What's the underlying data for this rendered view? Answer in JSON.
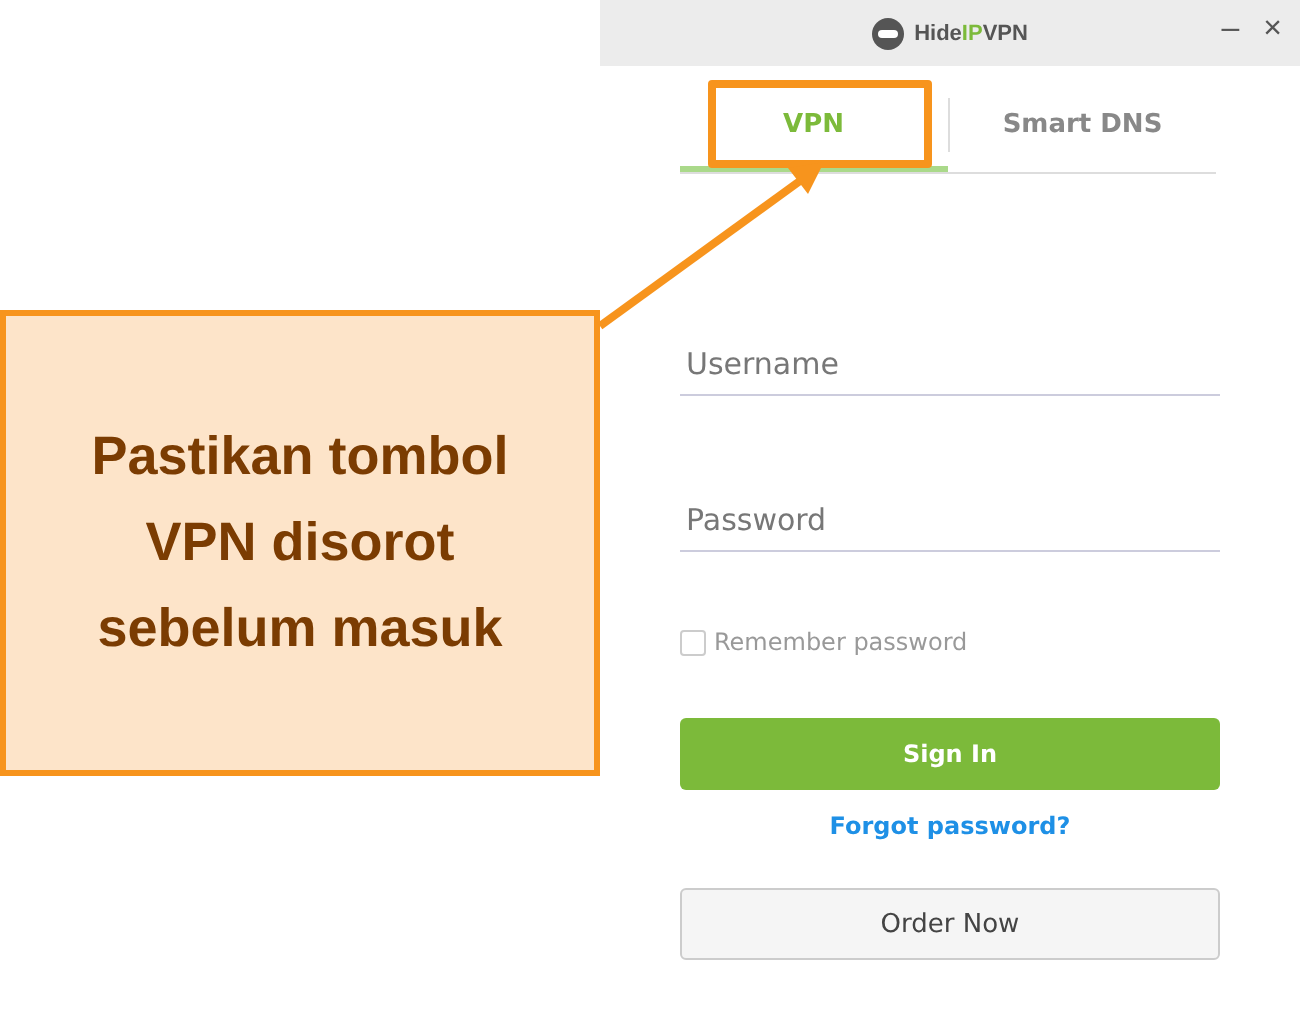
{
  "window": {
    "logo": [
      {
        "text": "Hide",
        "accent": false
      },
      {
        "text": "IP",
        "accent": true
      },
      {
        "text": "VPN",
        "accent": false
      }
    ],
    "controls": [
      "–",
      "×"
    ]
  },
  "tabs": [
    {
      "label": "VPN",
      "selected": true
    },
    {
      "label": "Smart DNS",
      "selected": false
    }
  ],
  "form": {
    "username": {
      "placeholder": "Username"
    },
    "password": {
      "placeholder": "Password"
    },
    "remember": {
      "label": "Remember password",
      "checked": false
    },
    "sign_in": "Sign In",
    "forgot": "Forgot password?",
    "order": "Order Now"
  },
  "callout": {
    "text": "Pastikan tombol VPN disorot sebelum masuk"
  }
}
